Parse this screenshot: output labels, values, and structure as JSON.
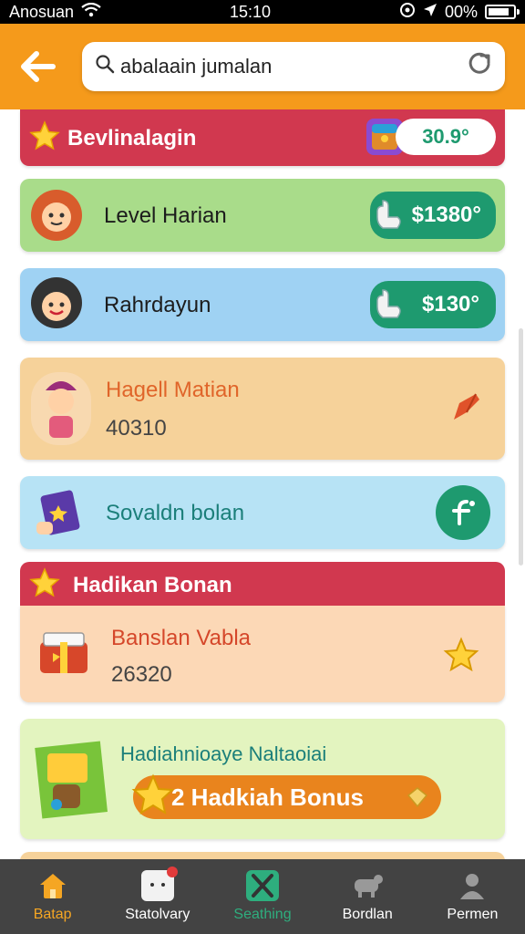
{
  "status_bar": {
    "carrier": "Anosuan",
    "time": "15:10",
    "battery": "00%"
  },
  "header": {
    "search_value": "abalaain jumalan"
  },
  "list": {
    "section1": {
      "title": "Bevlinalagin",
      "value": "30.9°"
    },
    "item1": {
      "title": "Level Harian",
      "value": "$1380°"
    },
    "item2": {
      "title": "Rahrdayun",
      "value": "$130°"
    },
    "item3": {
      "title": "Hagell Matian",
      "value": "40310"
    },
    "item4": {
      "title": "Sovaldn bolan"
    },
    "section2": {
      "title": "Hadikan Bonan"
    },
    "item5": {
      "title": "Banslan Vabla",
      "value": "26320"
    },
    "item6": {
      "title": "Hadiahnioaye Naltaoiai",
      "bonus_label": "2 Hadkiah Bonus"
    }
  },
  "nav": [
    {
      "label": "Batap"
    },
    {
      "label": "Statolvary"
    },
    {
      "label": "Seathing"
    },
    {
      "label": "Bordlan"
    },
    {
      "label": "Permen"
    }
  ],
  "colors": {
    "header": "#f59a1b",
    "section_red": "#d1384f",
    "green_pill": "#1e9a6f",
    "nav_bg": "#434343",
    "nav_active": "#f5a623",
    "nav_green": "#2eae7e"
  }
}
